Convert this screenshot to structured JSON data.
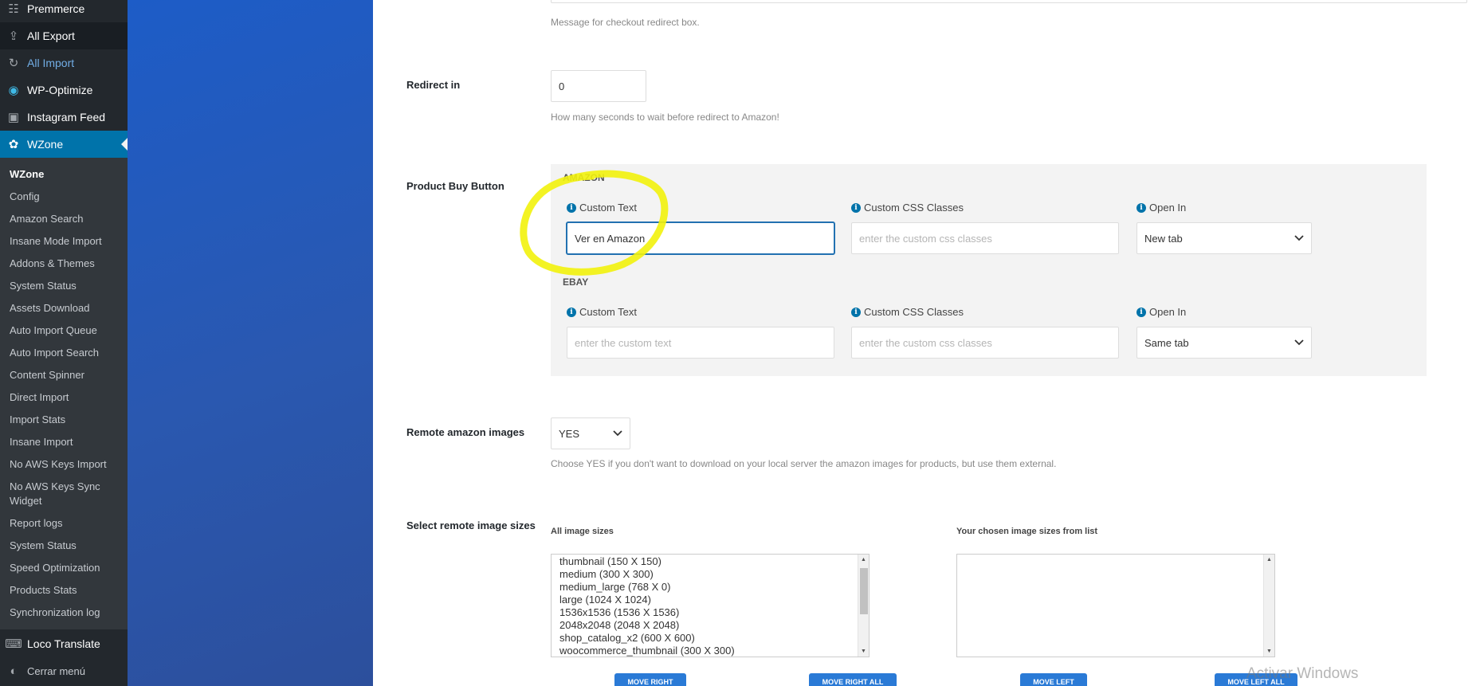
{
  "sidebar": {
    "top_items": [
      {
        "label": "Premmerce",
        "icon": "premmerce-icon"
      },
      {
        "label": "All Export",
        "icon": "export-icon"
      },
      {
        "label": "All Import",
        "icon": "import-icon"
      },
      {
        "label": "WP-Optimize",
        "icon": "optimize-icon"
      },
      {
        "label": "Instagram Feed",
        "icon": "camera-icon"
      },
      {
        "label": "WZone",
        "icon": "wzone-icon"
      }
    ],
    "sub_items": [
      "WZone",
      "Config",
      "Amazon Search",
      "Insane Mode Import",
      "Addons & Themes",
      "System Status",
      "Assets Download",
      "Auto Import Queue",
      "Auto Import Search",
      "Content Spinner",
      "Direct Import",
      "Import Stats",
      "Insane Import",
      "No AWS Keys Import",
      "No AWS Keys Sync Widget",
      "Report logs",
      "System Status",
      "Speed Optimization",
      "Products Stats",
      "Synchronization log"
    ],
    "bottom_items": [
      {
        "label": "Loco Translate",
        "icon": "translate-icon"
      },
      {
        "label": "Cerrar menú",
        "icon": "collapse-icon"
      }
    ]
  },
  "main": {
    "checkout_message_desc": "Message for checkout redirect box.",
    "redirect": {
      "label": "Redirect in",
      "value": "0",
      "desc": "How many seconds to wait before redirect to Amazon!"
    },
    "buy_button": {
      "label": "Product Buy Button",
      "amazon": {
        "title": "AMAZON",
        "custom_text_label": "Custom Text",
        "custom_text_value": "Ver en Amazon",
        "css_label": "Custom CSS Classes",
        "css_placeholder": "enter the custom css classes",
        "open_label": "Open In",
        "open_value": "New tab"
      },
      "ebay": {
        "title": "EBAY",
        "custom_text_label": "Custom Text",
        "custom_text_placeholder": "enter the custom text",
        "css_label": "Custom CSS Classes",
        "css_placeholder": "enter the custom css classes",
        "open_label": "Open In",
        "open_value": "Same tab"
      }
    },
    "remote_images": {
      "label": "Remote amazon images",
      "value": "YES",
      "desc": "Choose YES if you don't want to download on your local server the amazon images for products, but use them external."
    },
    "image_sizes": {
      "label": "Select remote image sizes",
      "all_title": "All image sizes",
      "chosen_title": "Your chosen image sizes from list",
      "options": [
        "thumbnail (150 X 150)",
        "medium (300 X 300)",
        "medium_large (768 X 0)",
        "large (1024 X 1024)",
        "1536x1536 (1536 X 1536)",
        "2048x2048 (2048 X 2048)",
        "shop_catalog_x2 (600 X 600)",
        "woocommerce_thumbnail (300 X 300)"
      ],
      "buttons": [
        "MOVE RIGHT",
        "MOVE RIGHT ALL",
        "MOVE LEFT",
        "MOVE LEFT ALL"
      ]
    },
    "watermark": "Activar Windows"
  },
  "colors": {
    "sidebar_bg": "#23282d",
    "submenu_bg": "#32373c",
    "active_menu": "#0073aa",
    "blue_panel": "#2a58b0",
    "highlight": "#f2f20c",
    "button_blue": "#2a7ad6"
  }
}
